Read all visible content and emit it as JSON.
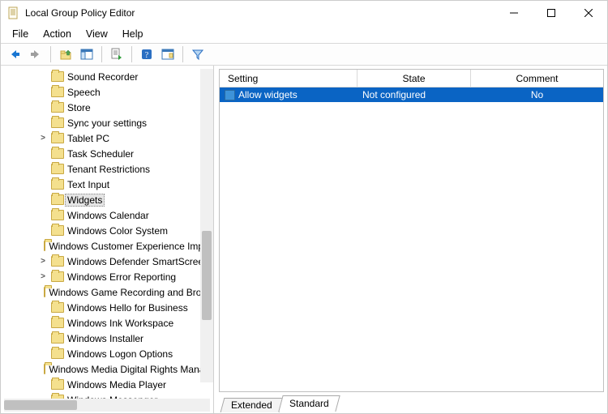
{
  "window": {
    "title": "Local Group Policy Editor"
  },
  "menu": {
    "file": "File",
    "action": "Action",
    "view": "View",
    "help": "Help"
  },
  "toolbar_icons": {
    "back": "back-arrow",
    "forward": "forward-arrow",
    "up": "folder-up",
    "show_hide_tree": "show-hide-tree",
    "export": "export-list",
    "help": "help",
    "properties": "properties",
    "filter": "filter"
  },
  "tree": {
    "items": [
      {
        "label": "Sound Recorder",
        "expander": "none"
      },
      {
        "label": "Speech",
        "expander": "none"
      },
      {
        "label": "Store",
        "expander": "none"
      },
      {
        "label": "Sync your settings",
        "expander": "none"
      },
      {
        "label": "Tablet PC",
        "expander": "closed"
      },
      {
        "label": "Task Scheduler",
        "expander": "none"
      },
      {
        "label": "Tenant Restrictions",
        "expander": "none"
      },
      {
        "label": "Text Input",
        "expander": "none"
      },
      {
        "label": "Widgets",
        "expander": "none",
        "selected": true
      },
      {
        "label": "Windows Calendar",
        "expander": "none"
      },
      {
        "label": "Windows Color System",
        "expander": "none"
      },
      {
        "label": "Windows Customer Experience Improvement Program",
        "expander": "none"
      },
      {
        "label": "Windows Defender SmartScreen",
        "expander": "closed"
      },
      {
        "label": "Windows Error Reporting",
        "expander": "closed"
      },
      {
        "label": "Windows Game Recording and Broadcasting",
        "expander": "none"
      },
      {
        "label": "Windows Hello for Business",
        "expander": "none"
      },
      {
        "label": "Windows Ink Workspace",
        "expander": "none"
      },
      {
        "label": "Windows Installer",
        "expander": "none"
      },
      {
        "label": "Windows Logon Options",
        "expander": "none"
      },
      {
        "label": "Windows Media Digital Rights Management",
        "expander": "none"
      },
      {
        "label": "Windows Media Player",
        "expander": "none"
      },
      {
        "label": "Windows Messenger",
        "expander": "none"
      }
    ]
  },
  "grid": {
    "columns": {
      "setting": "Setting",
      "state": "State",
      "comment": "Comment"
    },
    "rows": [
      {
        "setting": "Allow widgets",
        "state": "Not configured",
        "comment": "No",
        "selected": true
      }
    ]
  },
  "tabs": {
    "extended": "Extended",
    "standard": "Standard",
    "active": "standard"
  }
}
